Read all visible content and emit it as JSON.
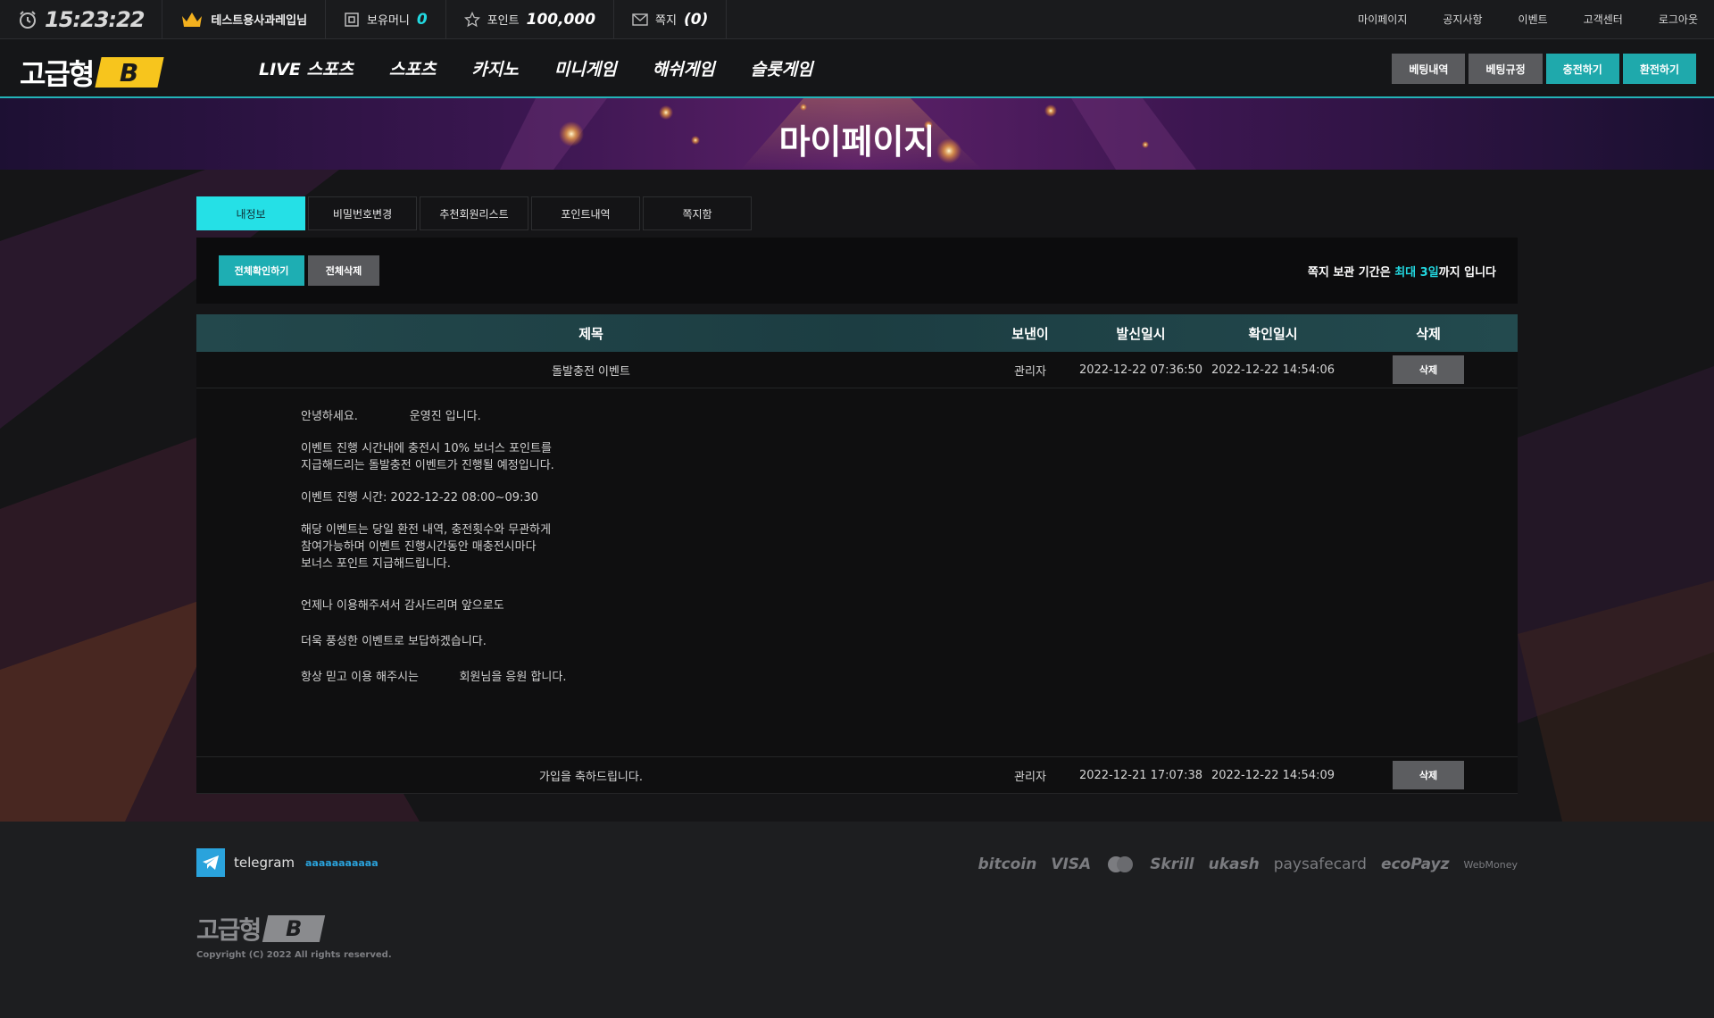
{
  "topbar": {
    "clock": "15:23:22",
    "user": "테스트용사과레입님",
    "money_label": "보유머니",
    "money_value": "0",
    "point_label": "포인트",
    "point_value": "100,000",
    "message_label": "쪽지",
    "message_value": "(0)",
    "links": [
      "마이페이지",
      "공지사항",
      "이벤트",
      "고객센터",
      "로그아웃"
    ]
  },
  "header": {
    "logo_text": "고급형",
    "logo_badge": "B",
    "nav": [
      "LIVE 스포츠",
      "스포츠",
      "카지노",
      "미니게임",
      "해쉬게임",
      "슬롯게임"
    ],
    "buttons": [
      "베팅내역",
      "베팅규정",
      "충전하기",
      "환전하기"
    ]
  },
  "banner": {
    "title": "마이페이지"
  },
  "tabs": [
    "내정보",
    "비밀번호변경",
    "추천회원리스트",
    "포인트내역",
    "쪽지함"
  ],
  "actions": {
    "read_all": "전체확인하기",
    "delete_all": "전체삭제",
    "notice_prefix": "쪽지 보관 기간은 ",
    "notice_highlight": "최대 3일",
    "notice_suffix": "까지 입니다"
  },
  "table": {
    "headers": [
      "제목",
      "보낸이",
      "발신일시",
      "확인일시",
      "삭제"
    ],
    "rows": [
      {
        "title": "돌발충전 이벤트",
        "sender": "관리자",
        "sent": "2022-12-22 07:36:50",
        "read": "2022-12-22 14:54:06",
        "delete": "삭제"
      },
      {
        "title": "가입을 축하드립니다.",
        "sender": "관리자",
        "sent": "2022-12-21 17:07:38",
        "read": "2022-12-22 14:54:09",
        "delete": "삭제"
      }
    ],
    "message_lines": {
      "l1": "안녕하세요.              운영진 입니다.",
      "l2": "이벤트 진행 시간내에 충전시 10% 보너스 포인트를",
      "l3": "지급해드리는 돌발충전 이벤트가 진행될 예정입니다.",
      "l4": "이벤트 진행 시간: 2022-12-22 08:00~09:30",
      "l5": "해당 이벤트는 당일 환전 내역, 충전횟수와 무관하게",
      "l6": "참여가능하며 이벤트 진행시간동안 매충전시마다",
      "l7": "보너스 포인트 지급해드립니다.",
      "l8": "언제나 이용해주셔서 감사드리며 앞으로도",
      "l9": "더욱 풍성한 이벤트로 보답하겠습니다.",
      "l10": "항상 믿고 이용 해주시는           회원님을 응원 합니다."
    }
  },
  "footer": {
    "telegram_label": "telegram",
    "telegram_handle": "aaaaaaaaaaa",
    "payments": [
      "bitcoin",
      "VISA",
      "Skrill",
      "ukash",
      "paysafecard",
      "ecoPayz",
      "WebMoney"
    ],
    "logo_text": "고급형",
    "logo_badge": "B",
    "copyright": "Copyright (C) 2022 All rights reserved."
  },
  "colors": {
    "accent": "#25e0e6",
    "teal_button": "#1fa9ac",
    "gray_button": "#5a5b5e",
    "logo_yellow": "#f7c51d"
  }
}
